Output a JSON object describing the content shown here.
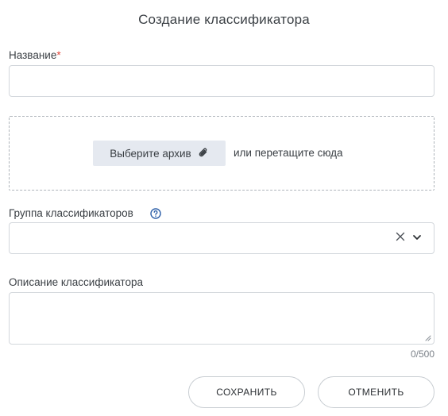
{
  "dialog": {
    "title": "Создание классификатора"
  },
  "name_field": {
    "label": "Название",
    "required_mark": "*",
    "value": ""
  },
  "upload": {
    "button_label": "Выберите архив",
    "button_icon": "paperclip-icon",
    "hint": "или перетащите сюда"
  },
  "group_field": {
    "label": "Группа классификаторов",
    "help_icon": "question-circle-icon",
    "value": "",
    "clear_icon": "close-icon",
    "dropdown_icon": "chevron-down-icon"
  },
  "description_field": {
    "label": "Описание классификатора",
    "value": "",
    "counter": "0/500"
  },
  "actions": {
    "save_label": "СОХРАНИТЬ",
    "cancel_label": "ОТМЕНИТЬ"
  },
  "colors": {
    "required": "#e0483c",
    "help_icon": "#2d5fa8",
    "upload_button_bg": "#e5e9f0"
  }
}
